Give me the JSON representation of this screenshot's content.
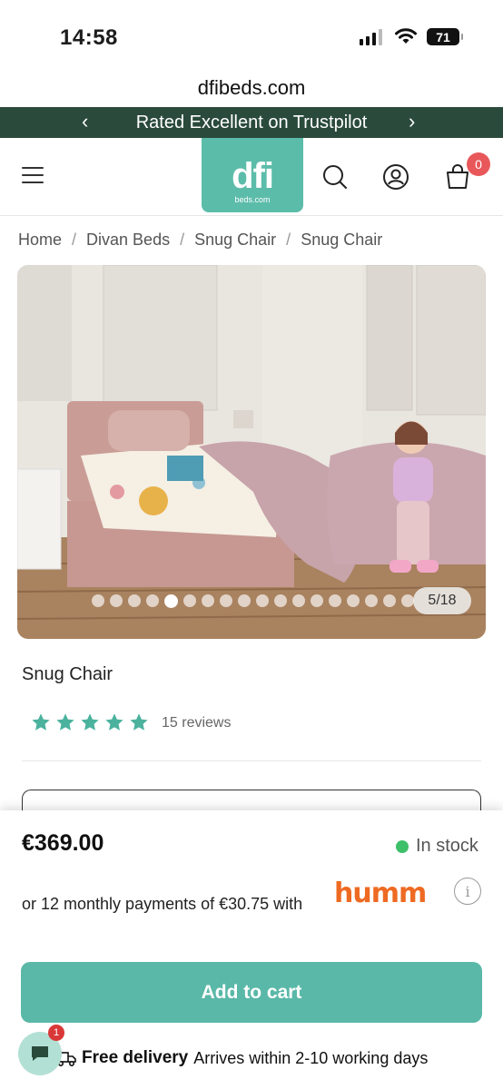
{
  "status_bar": {
    "time": "14:58",
    "battery": "71",
    "icons": [
      "signal-icon",
      "wifi-icon",
      "battery-icon"
    ]
  },
  "browser": {
    "url": "dfibeds.com"
  },
  "promo": {
    "text": "Rated Excellent on Trustpilot",
    "prev_icon": "chevron-left-icon",
    "next_icon": "chevron-right-icon"
  },
  "header": {
    "menu_icon": "hamburger-icon",
    "logo_main": "dfi",
    "logo_sub": "beds.com",
    "search_icon": "search-icon",
    "account_icon": "user-icon",
    "cart_icon": "cart-icon",
    "cart_count": "0"
  },
  "breadcrumb": [
    "Home",
    "Divan Beds",
    "Snug Chair",
    "Snug Chair"
  ],
  "gallery": {
    "counter": "5/18",
    "total_dots": 18,
    "active_index": 4
  },
  "product": {
    "title": "Snug Chair",
    "rating": 5,
    "reviews": "15 reviews",
    "price": "€369.00",
    "stock": "In stock",
    "monthly": "or 12 monthly payments of €30.75 with",
    "humm_logo": "humm",
    "info_icon": "info-icon",
    "add_to_cart": "Add to cart",
    "delivery_label": "Free delivery",
    "delivery_time": "Arrives within 2-10 working days",
    "delivery_icon": "truck-icon"
  },
  "chat": {
    "icon": "chat-icon",
    "badge": "1"
  },
  "colors": {
    "promo_bg": "#2a4a3c",
    "brand": "#5cbcaa",
    "button": "#5ab8a8",
    "star": "#4bb29e",
    "stock_dot": "#3ebf6a",
    "humm": "#ee6a23",
    "badge": "#e8585a"
  }
}
